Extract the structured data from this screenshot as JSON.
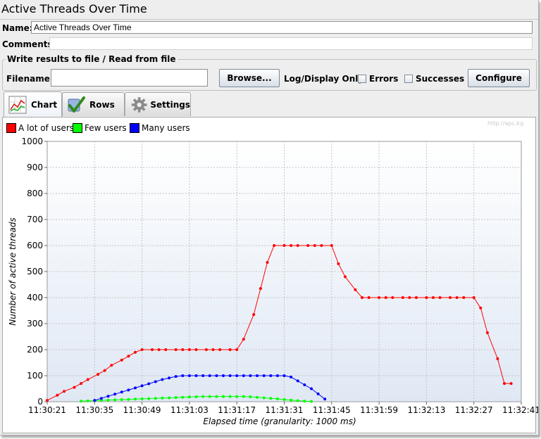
{
  "window_title": "Active Threads Over Time",
  "name_label": "Name:",
  "name_value": "Active Threads Over Time",
  "comments_label": "Comments:",
  "comments_value": "",
  "file_group_title": "Write results to file / Read from file",
  "filename_label": "Filename",
  "filename_value": "",
  "browse_label": "Browse...",
  "log_display_label": "Log/Display Only:",
  "errors_label": "Errors",
  "errors_checked": false,
  "successes_label": "Successes",
  "successes_checked": false,
  "configure_label": "Configure",
  "tabs": [
    {
      "label": "Chart",
      "icon": "chart-icon",
      "active": true
    },
    {
      "label": "Rows",
      "icon": "checkmark-icon",
      "active": false
    },
    {
      "label": "Settings",
      "icon": "gear-icon",
      "active": false
    }
  ],
  "watermark": "http://apc.kg",
  "chart_data": {
    "type": "line",
    "xlabel": "Elapsed time (granularity: 1000 ms)",
    "ylabel": "Number of active threads",
    "ylim": [
      0,
      1000
    ],
    "yticks": [
      0,
      100,
      200,
      300,
      400,
      500,
      600,
      700,
      800,
      900,
      1000
    ],
    "xlim": [
      "11:30:21",
      "11:32:41"
    ],
    "xticks": [
      "11:30:21",
      "11:30:35",
      "11:30:49",
      "11:31:03",
      "11:31:17",
      "11:31:31",
      "11:31:45",
      "11:31:59",
      "11:32:13",
      "11:32:27",
      "11:32:41"
    ],
    "grid": true,
    "legend_position": "top-left",
    "series": [
      {
        "name": "A lot of users",
        "color": "#ff0000",
        "x": [
          "11:30:21",
          "11:30:24",
          "11:30:26",
          "11:30:29",
          "11:30:31",
          "11:30:33",
          "11:30:36",
          "11:30:38",
          "11:30:40",
          "11:30:43",
          "11:30:45",
          "11:30:47",
          "11:30:49",
          "11:30:52",
          "11:30:54",
          "11:30:56",
          "11:30:59",
          "11:31:01",
          "11:31:03",
          "11:31:05",
          "11:31:08",
          "11:31:10",
          "11:31:12",
          "11:31:15",
          "11:31:17",
          "11:31:19",
          "11:31:22",
          "11:31:24",
          "11:31:26",
          "11:31:28",
          "11:31:31",
          "11:31:33",
          "11:31:35",
          "11:31:38",
          "11:31:40",
          "11:31:42",
          "11:31:45",
          "11:31:47",
          "11:31:49",
          "11:31:52",
          "11:31:54",
          "11:31:56",
          "11:31:59",
          "11:32:01",
          "11:32:03",
          "11:32:06",
          "11:32:08",
          "11:32:10",
          "11:32:13",
          "11:32:15",
          "11:32:17",
          "11:32:20",
          "11:32:22",
          "11:32:24",
          "11:32:27",
          "11:32:29",
          "11:32:31",
          "11:32:34",
          "11:32:36",
          "11:32:38"
        ],
        "y": [
          5,
          25,
          40,
          55,
          70,
          85,
          105,
          120,
          140,
          160,
          175,
          190,
          200,
          200,
          200,
          200,
          200,
          200,
          200,
          200,
          200,
          200,
          200,
          200,
          200,
          240,
          335,
          435,
          535,
          600,
          600,
          600,
          600,
          600,
          600,
          600,
          600,
          530,
          480,
          430,
          400,
          400,
          400,
          400,
          400,
          400,
          400,
          400,
          400,
          400,
          400,
          400,
          400,
          400,
          400,
          360,
          265,
          165,
          70,
          70
        ]
      },
      {
        "name": "Few users",
        "color": "#00ff00",
        "x": [
          "11:30:31",
          "11:30:33",
          "11:30:35",
          "11:30:37",
          "11:30:39",
          "11:30:41",
          "11:30:43",
          "11:30:45",
          "11:30:47",
          "11:30:49",
          "11:30:51",
          "11:30:53",
          "11:30:55",
          "11:30:57",
          "11:30:59",
          "11:31:01",
          "11:31:03",
          "11:31:05",
          "11:31:07",
          "11:31:09",
          "11:31:11",
          "11:31:13",
          "11:31:15",
          "11:31:17",
          "11:31:19",
          "11:31:21",
          "11:31:23",
          "11:31:25",
          "11:31:27",
          "11:31:29",
          "11:31:31",
          "11:31:33",
          "11:31:35",
          "11:31:37",
          "11:31:39"
        ],
        "y": [
          2,
          3,
          4,
          5,
          6,
          7,
          8,
          9,
          10,
          11,
          12,
          13,
          14,
          15,
          16,
          17,
          18,
          19,
          20,
          20,
          20,
          20,
          20,
          20,
          20,
          19,
          17,
          15,
          13,
          11,
          8,
          6,
          4,
          2,
          1
        ]
      },
      {
        "name": "Many users",
        "color": "#0000ff",
        "x": [
          "11:30:35",
          "11:30:37",
          "11:30:39",
          "11:30:41",
          "11:30:43",
          "11:30:45",
          "11:30:47",
          "11:30:49",
          "11:30:51",
          "11:30:53",
          "11:30:55",
          "11:30:57",
          "11:30:59",
          "11:31:01",
          "11:31:03",
          "11:31:05",
          "11:31:07",
          "11:31:09",
          "11:31:11",
          "11:31:13",
          "11:31:15",
          "11:31:17",
          "11:31:19",
          "11:31:21",
          "11:31:23",
          "11:31:25",
          "11:31:27",
          "11:31:29",
          "11:31:31",
          "11:31:33",
          "11:31:35",
          "11:31:37",
          "11:31:39",
          "11:31:41",
          "11:31:43"
        ],
        "y": [
          5,
          13,
          21,
          29,
          37,
          45,
          53,
          61,
          69,
          77,
          85,
          91,
          97,
          100,
          100,
          100,
          100,
          100,
          100,
          100,
          100,
          100,
          100,
          100,
          100,
          100,
          100,
          100,
          100,
          95,
          80,
          65,
          50,
          30,
          10
        ]
      }
    ]
  }
}
